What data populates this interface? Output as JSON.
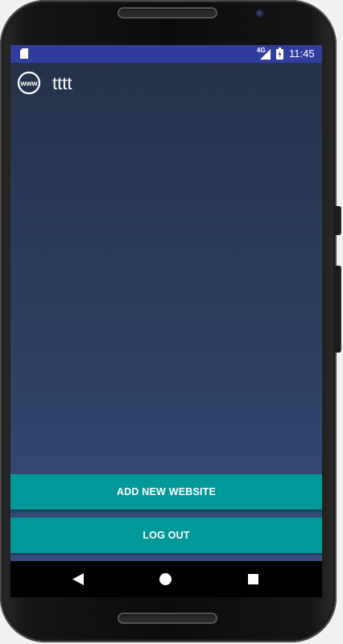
{
  "status_bar": {
    "network_label": "4G",
    "time": "11:45",
    "icons": [
      "sd-card-icon",
      "signal-icon",
      "battery-icon"
    ],
    "background": "#2f3e9e"
  },
  "app": {
    "title": "tttt",
    "header_icon": "www-globe-icon",
    "header_icon_text": "www",
    "background_top": "#25324a",
    "background_bottom": "#354e7c"
  },
  "buttons": {
    "add_website": "ADD NEW WEBSITE",
    "logout": "LOG OUT",
    "color": "#009999"
  },
  "nav_bar": {
    "icons": [
      "back-icon",
      "home-icon",
      "recents-icon"
    ]
  }
}
